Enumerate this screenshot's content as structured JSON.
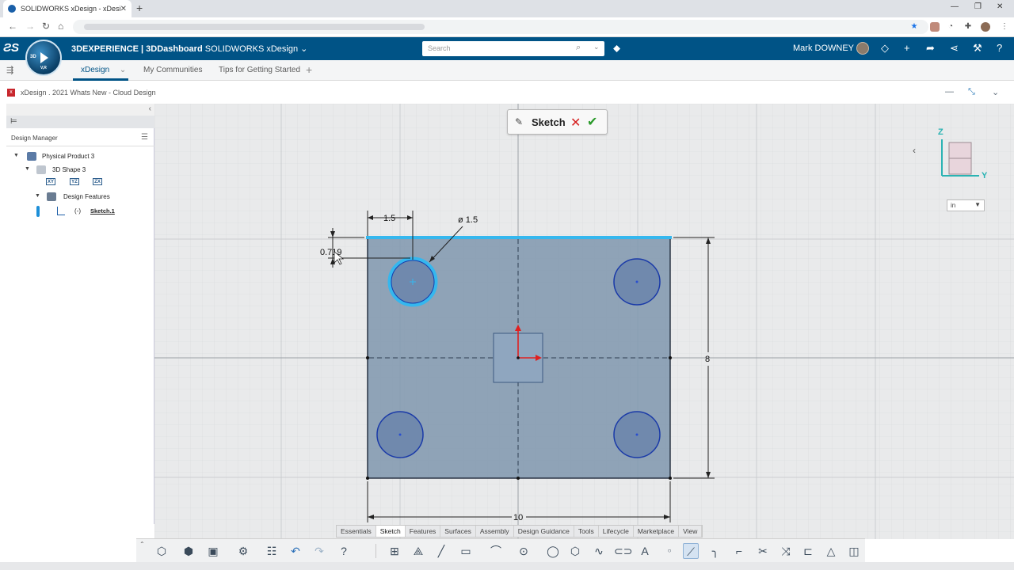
{
  "browser": {
    "tab_title": "SOLIDWORKS xDesign - xDesign",
    "tab_close": "✕",
    "new_tab": "+",
    "controls": [
      "—",
      "❐",
      "✕"
    ]
  },
  "topbar": {
    "brand_bold": "3DEXPERIENCE | 3DDashboard",
    "brand_app": " SOLIDWORKS xDesign",
    "brand_caret": "⌄",
    "search_placeholder": "Search",
    "user_name": "Mark DOWNEY",
    "compass_3d": "3D",
    "compass_vr": "V,R"
  },
  "tabs": {
    "items": [
      "xDesign",
      "My Communities",
      "Tips for Getting Started"
    ],
    "caret": "⌄",
    "add": "+"
  },
  "document": {
    "title": "xDesign . 2021 Whats New - Cloud Design",
    "icon": "x"
  },
  "design_manager": {
    "label": "Design Manager",
    "tree": [
      {
        "label": "Physical Product 3"
      },
      {
        "label": "3D Shape 3"
      },
      {
        "label": "Design Features"
      },
      {
        "label": "(-)"
      },
      {
        "label": "Sketch.1"
      }
    ],
    "plane_icons": [
      "XY",
      "YZ",
      "ZX"
    ]
  },
  "sketch_popup": {
    "label": "Sketch"
  },
  "dimensions": {
    "top_offset": "1.5",
    "hole_diameter": "ø 1.5",
    "vertical_offset": "0.719",
    "height": "8",
    "width": "10"
  },
  "triad": {
    "z": "Z",
    "y": "Y"
  },
  "units": {
    "value": "in"
  },
  "bottom_tabs": {
    "items": [
      "Essentials",
      "Sketch",
      "Features",
      "Surfaces",
      "Assembly",
      "Design Guidance",
      "Tools",
      "Lifecycle",
      "Marketplace",
      "View"
    ],
    "active": "Sketch"
  },
  "colors": {
    "topbar": "#005386",
    "sketch_fill": "#7f96ae",
    "selection": "#35b7ee",
    "circle_edge": "#1a3aa8"
  }
}
